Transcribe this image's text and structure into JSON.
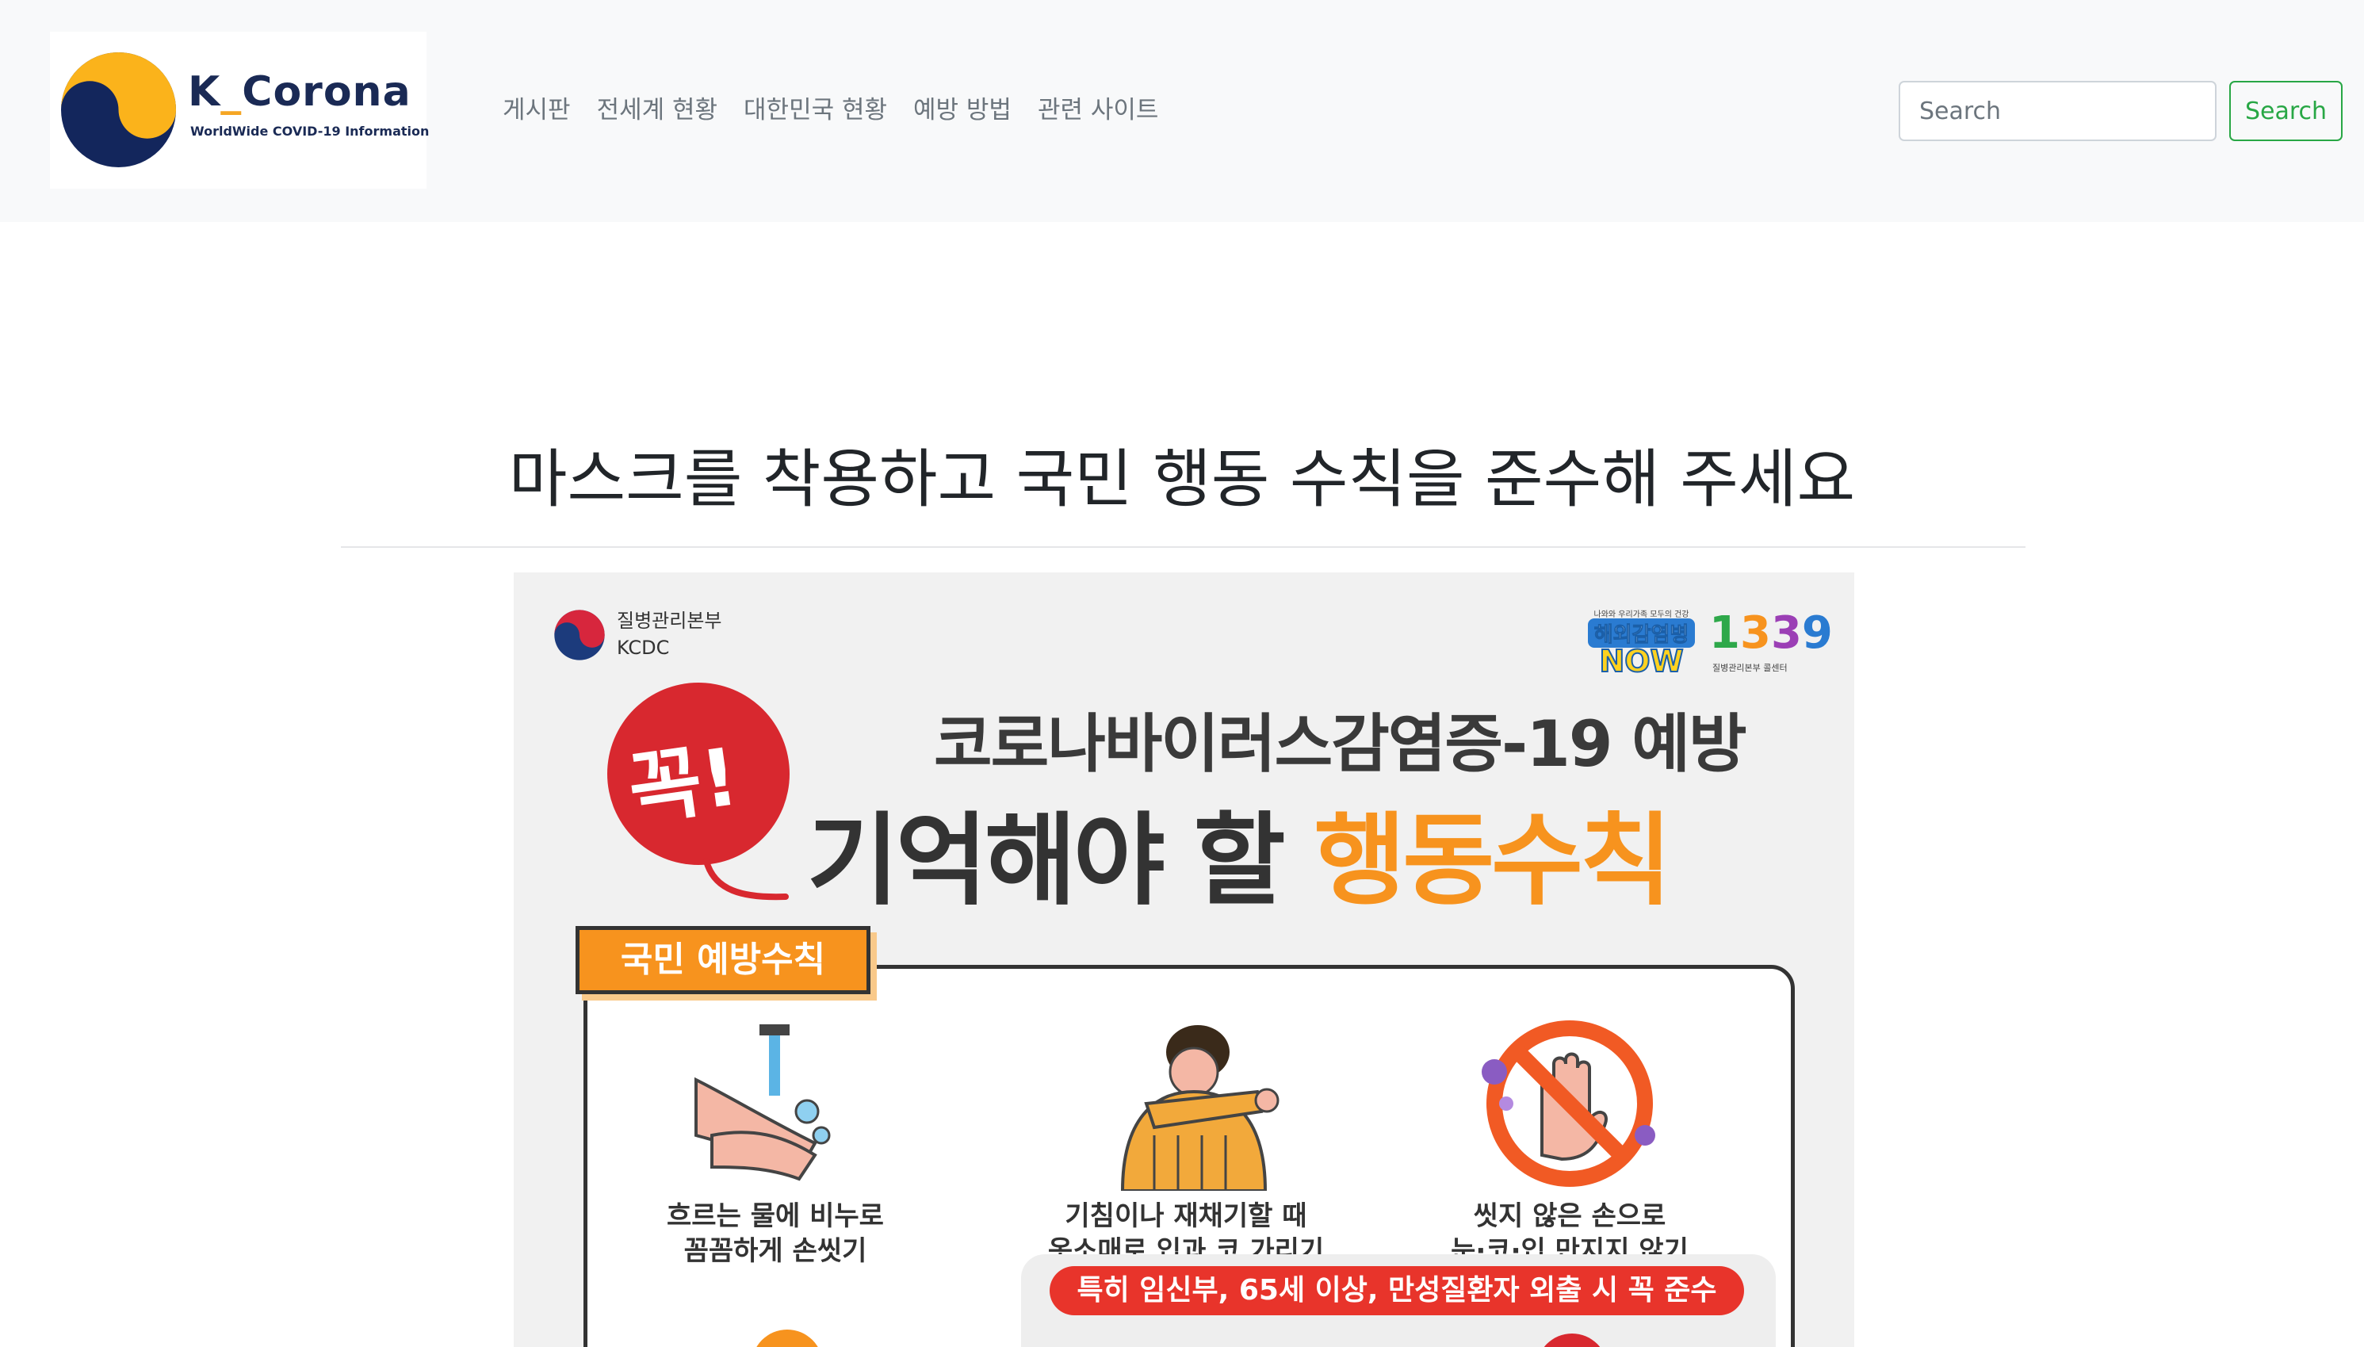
{
  "navbar": {
    "brand": {
      "title_part1": "K",
      "title_sep": "_",
      "title_part2": "Corona",
      "subtitle": "WorldWide COVID-19 Information"
    },
    "links": [
      "게시판",
      "전세계 현황",
      "대한민국 현황",
      "예방 방법",
      "관련 사이트"
    ],
    "search": {
      "placeholder": "Search",
      "button_label": "Search"
    }
  },
  "main": {
    "title": "마스크를 착용하고 국민 행동 수칙을 준수해 주세요"
  },
  "poster": {
    "org_name_ko": "질병관리본부",
    "org_name_en": "KCDC",
    "badge_small": "나와와 우리가족 모두의 건강",
    "badge_top": "해외감염병",
    "badge_bottom": "NOW",
    "hotline_digits": [
      "1",
      "3",
      "3",
      "9"
    ],
    "hotline_caption": "질병관리본부 콜센터",
    "bubble_text": "꼭!",
    "headline_line1": "코로나바이러스감염증-19 예방",
    "headline_line2_plain": "기억해야 할 ",
    "headline_line2_highlight": "행동수칙",
    "section_tag": "국민 예방수칙",
    "rules": [
      {
        "line1": "흐르는 물에 비누로",
        "line2": "꼼꼼하게 손씻기"
      },
      {
        "line1": "기침이나 재채기할 때",
        "line2": "옷소매로 입과 코 가리기"
      },
      {
        "line1": "씻지 않은 손으로",
        "line2": "눈·코·입 만지지 않기"
      }
    ],
    "notice": "특히 임신부, 65세 이상, 만성질환자 외출 시 꼭 준수"
  },
  "colors": {
    "navbar_bg": "#f8f9fa",
    "brand_navy": "#1a2a55",
    "brand_yellow": "#f5a623",
    "search_green": "#28a745",
    "poster_orange": "#f7931e",
    "poster_red": "#e8342b"
  },
  "icons": {
    "brand_logo": "taegeuk-circle-icon",
    "kcdc_logo": "taegeuk-small-icon",
    "rule1": "hand-washing-icon",
    "rule2": "cough-into-sleeve-icon",
    "rule3": "no-touch-face-icon"
  }
}
